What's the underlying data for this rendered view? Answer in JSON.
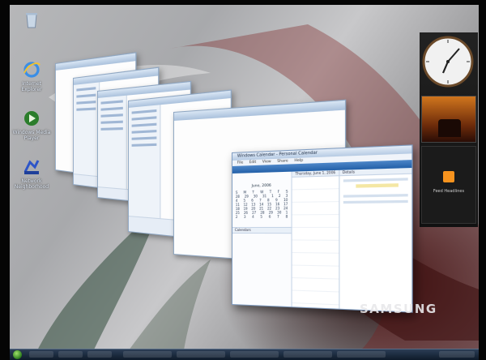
{
  "desktop": {
    "icons": [
      {
        "name": "recycle-bin-icon",
        "label": ""
      },
      {
        "name": "internet-explorer-icon",
        "label": "Internet Explorer"
      },
      {
        "name": "windows-media-icon",
        "label": "Windows Media Player"
      },
      {
        "name": "network-icon",
        "label": "Network Neighborhood"
      }
    ]
  },
  "flip3d": {
    "front_window": {
      "title": "Windows Calendar - Personal Calendar",
      "menu": [
        "File",
        "Edit",
        "View",
        "Share",
        "Help"
      ],
      "calendar": {
        "month": "June, 2006",
        "days": [
          "S",
          "M",
          "T",
          "W",
          "T",
          "F",
          "S"
        ],
        "weeks": [
          [
            "28",
            "29",
            "30",
            "31",
            "1",
            "2",
            "3"
          ],
          [
            "4",
            "5",
            "6",
            "7",
            "8",
            "9",
            "10"
          ],
          [
            "11",
            "12",
            "13",
            "14",
            "15",
            "16",
            "17"
          ],
          [
            "18",
            "19",
            "20",
            "21",
            "22",
            "23",
            "24"
          ],
          [
            "25",
            "26",
            "27",
            "28",
            "29",
            "30",
            "1"
          ],
          [
            "2",
            "3",
            "4",
            "5",
            "6",
            "7",
            "8"
          ]
        ]
      },
      "tasks_label": "Calendars",
      "day_header": "Thursday, June 1, 2006",
      "details_header": "Details"
    },
    "window_count": 6
  },
  "sidebar": {
    "clock_gadget": "clock",
    "slideshow_gadget": "photo",
    "feed_gadget": "Feed Headlines"
  },
  "brand": "SAMSUNG",
  "colors": {
    "window_border": "#7e9bc0",
    "toolbar": "#2360a8",
    "taskbar": "#0e1a2a"
  }
}
